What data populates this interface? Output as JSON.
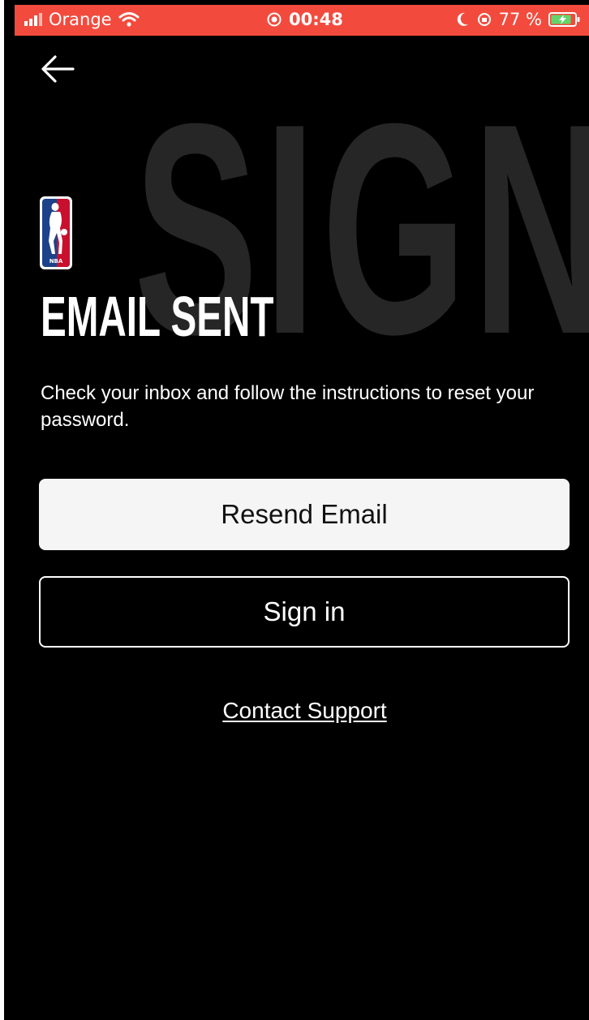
{
  "status_bar": {
    "carrier": "Orange",
    "time": "00:48",
    "battery": "77 %"
  },
  "background_word": "SIGN I",
  "logo": {
    "text": "NBA"
  },
  "title": "EMAIL SENT",
  "description": "Check your inbox and follow the instructions to reset your password.",
  "buttons": {
    "resend": "Resend Email",
    "signin": "Sign in"
  },
  "links": {
    "contact_support": "Contact Support"
  },
  "colors": {
    "status_bar": "#f24b3e",
    "background": "#000000",
    "primary_button": "#f5f5f5"
  }
}
